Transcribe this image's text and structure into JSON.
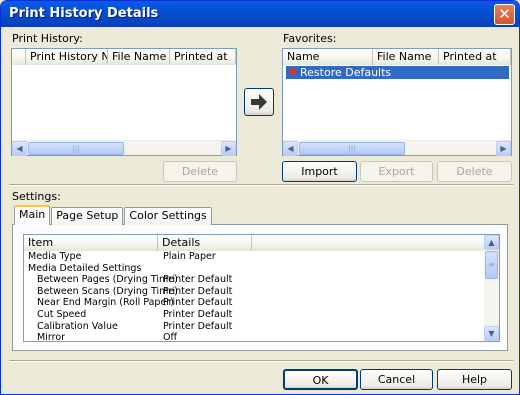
{
  "window": {
    "title": "Print History Details",
    "close_glyph": "✕"
  },
  "print_history": {
    "label": "Print History:",
    "columns": [
      "Print History Nu...",
      "File Name",
      "Printed at"
    ],
    "delete_label": "Delete"
  },
  "favorites": {
    "label": "Favorites:",
    "columns": [
      "Name",
      "File Name",
      "Printed at"
    ],
    "items": [
      "Restore Defaults"
    ],
    "import_label": "Import",
    "export_label": "Export",
    "delete_label": "Delete"
  },
  "move_arrow_icon": "right-arrow-icon",
  "settings": {
    "label": "Settings:",
    "tabs": [
      "Main",
      "Page Setup",
      "Color Settings"
    ],
    "columns": [
      "Item",
      "Details"
    ],
    "rows": [
      {
        "item": "Media Type",
        "details": "Plain Paper"
      },
      {
        "item": "Media Detailed Settings",
        "details": ""
      },
      {
        "item": "   Between Pages (Drying Time)",
        "details": "Printer Default"
      },
      {
        "item": "   Between Scans (Drying Time)",
        "details": "Printer Default"
      },
      {
        "item": "   Near End Margin (Roll Paper)",
        "details": "Printer Default"
      },
      {
        "item": "   Cut Speed",
        "details": "Printer Default"
      },
      {
        "item": "   Calibration Value",
        "details": "Printer Default"
      },
      {
        "item": "   Mirror",
        "details": "Off"
      }
    ]
  },
  "footer": {
    "ok_label": "OK",
    "cancel_label": "Cancel",
    "help_label": "Help"
  },
  "colors": {
    "title_bar": "#0553d6",
    "dialog_bg": "#ece9d8",
    "selection": "#316ac5"
  }
}
